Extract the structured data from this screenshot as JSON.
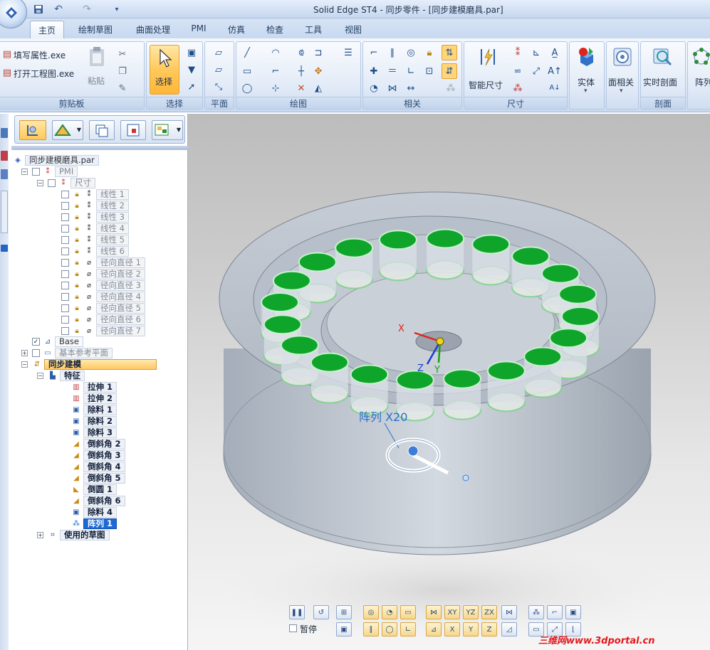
{
  "window": {
    "title": "Solid Edge ST4 - 同步零件 - [同步建模磨具.par]"
  },
  "quick_access": {
    "icons": [
      "save-icon",
      "undo-icon",
      "redo-icon",
      "customize-icon"
    ]
  },
  "tabs": [
    {
      "label": "主页",
      "active": true
    },
    {
      "label": "绘制草图"
    },
    {
      "label": "曲面处理"
    },
    {
      "label": "PMI"
    },
    {
      "label": "仿真"
    },
    {
      "label": "检查"
    },
    {
      "label": "工具"
    },
    {
      "label": "视图"
    }
  ],
  "ribbon": {
    "clipboard": {
      "label": "剪贴板",
      "fill_props": "填写属性.exe",
      "open_drawing": "打开工程图.exe",
      "paste": "粘贴"
    },
    "select": {
      "label": "选择",
      "button": "选择"
    },
    "plane": {
      "label": "平面"
    },
    "draw": {
      "label": "绘图"
    },
    "relate": {
      "label": "相关"
    },
    "dimension": {
      "label": "尺寸",
      "smart": "智能尺寸"
    },
    "solids": {
      "label": "实体"
    },
    "face_relate": {
      "label": "面相关"
    },
    "section": {
      "label": "剖面",
      "live": "实时剖面"
    },
    "pattern": {
      "label": "阵列"
    }
  },
  "pathfinder": {
    "root": "同步建模磨具.par",
    "pmi": "PMI",
    "dims": "尺寸",
    "linear": [
      "线性 1",
      "线性 2",
      "线性 3",
      "线性 4",
      "线性 5",
      "线性 6"
    ],
    "radial": [
      "径向直径 1",
      "径向直径 2",
      "径向直径 3",
      "径向直径 4",
      "径向直径 5",
      "径向直径 6",
      "径向直径 7"
    ],
    "base": "Base",
    "ref_planes": "基本参考平面",
    "sync": "同步建模",
    "features_label": "特征",
    "features": [
      {
        "name": "拉伸 1",
        "icon": "extrude-icon"
      },
      {
        "name": "拉伸 2",
        "icon": "extrude-icon"
      },
      {
        "name": "除料 1",
        "icon": "cut-icon"
      },
      {
        "name": "除料 2",
        "icon": "cut-icon"
      },
      {
        "name": "除料 3",
        "icon": "cut-icon"
      },
      {
        "name": "倒斜角 2",
        "icon": "chamfer-icon"
      },
      {
        "name": "倒斜角 3",
        "icon": "chamfer-icon"
      },
      {
        "name": "倒斜角 4",
        "icon": "chamfer-icon"
      },
      {
        "name": "倒斜角 5",
        "icon": "chamfer-icon"
      },
      {
        "name": "倒圆 1",
        "icon": "round-icon"
      },
      {
        "name": "倒斜角 6",
        "icon": "chamfer-icon"
      },
      {
        "name": "除料 4",
        "icon": "cut-icon"
      },
      {
        "name": "阵列 1",
        "icon": "pattern-icon",
        "selected": true
      }
    ],
    "used_sketches": "使用的草图"
  },
  "viewport": {
    "pattern_tag": "阵列 X20",
    "axes": {
      "x": "X",
      "y": "Y",
      "z": "Z"
    },
    "colors": {
      "pocket": "#0fa52a",
      "body": "#b9c3cf",
      "axis_x": "#e0241c",
      "axis_y": "#17a317",
      "axis_z": "#1f3dd1",
      "tag": "#2a6fc9"
    }
  },
  "bottom": {
    "pause": "暂停"
  },
  "watermark": "三维网www.3dportal.cn"
}
